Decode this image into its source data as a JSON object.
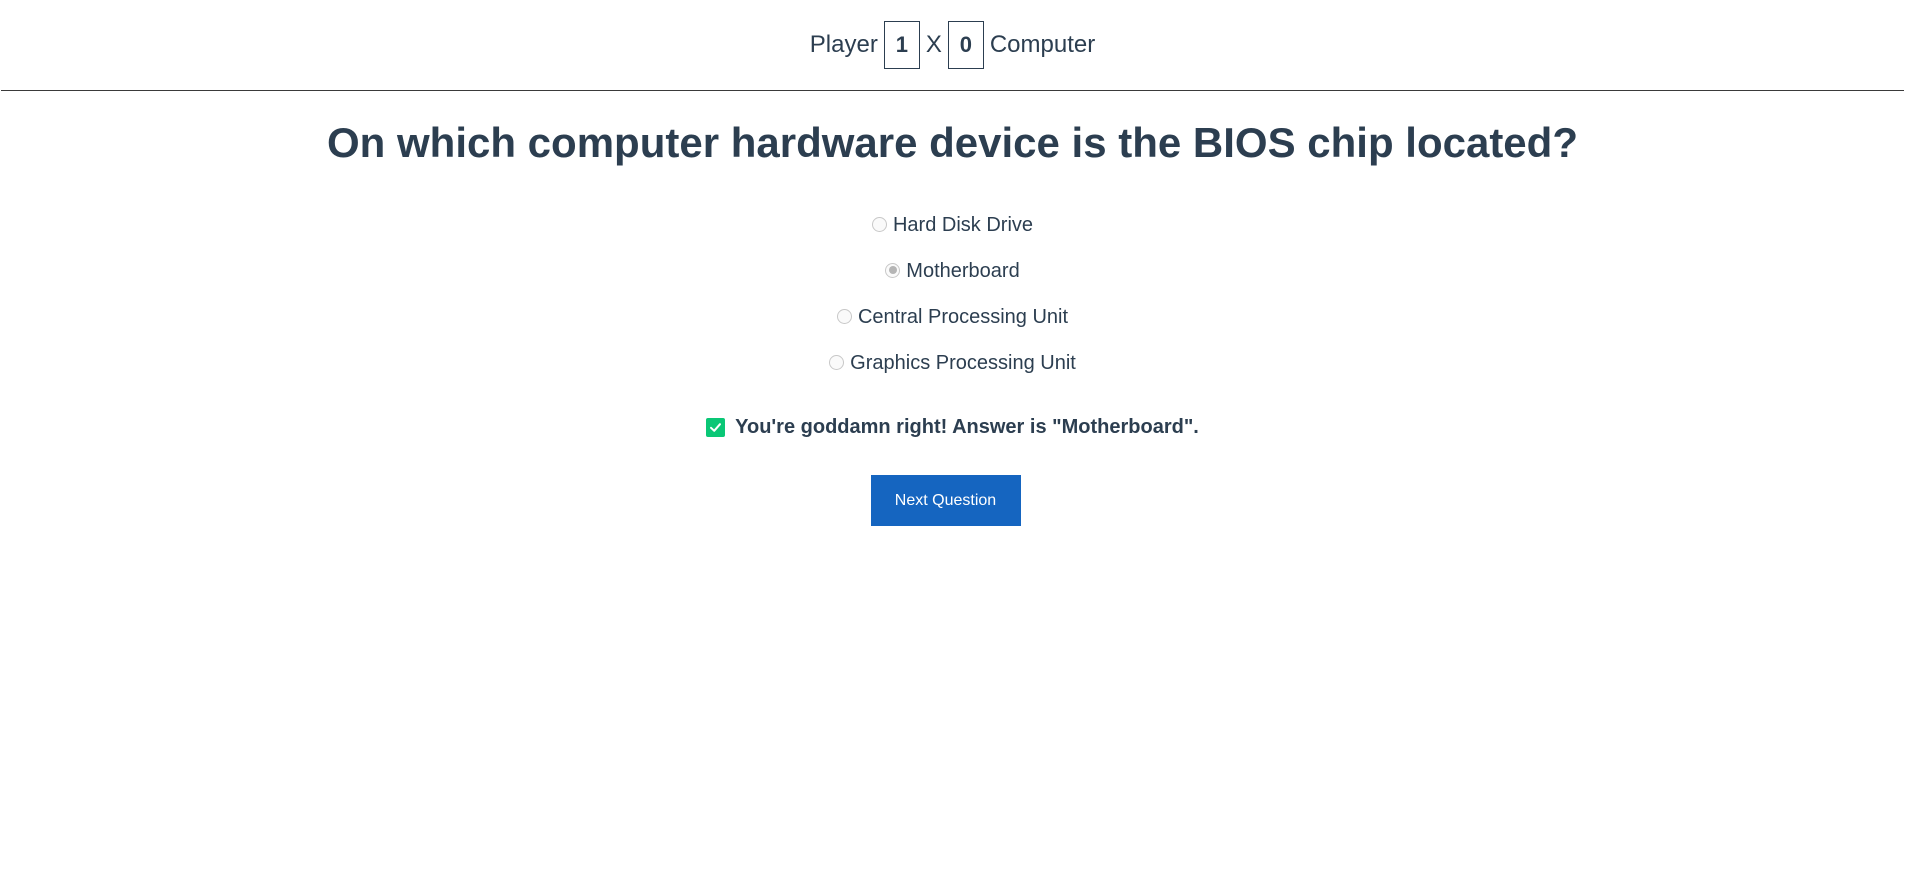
{
  "scoreboard": {
    "player_label": "Player",
    "player_score": "1",
    "separator": "X",
    "computer_score": "0",
    "computer_label": "Computer"
  },
  "question": {
    "text": "On which computer hardware device is the BIOS chip located?"
  },
  "options": [
    {
      "label": "Hard Disk Drive",
      "selected": false
    },
    {
      "label": "Motherboard",
      "selected": true
    },
    {
      "label": "Central Processing Unit",
      "selected": false
    },
    {
      "label": "Graphics Processing Unit",
      "selected": false
    }
  ],
  "result": {
    "icon": "check-icon",
    "text": "You're goddamn right! Answer is \"Motherboard\".",
    "accent": "#0ac776"
  },
  "actions": {
    "next_label": "Next Question",
    "button_color": "#1565c0"
  }
}
